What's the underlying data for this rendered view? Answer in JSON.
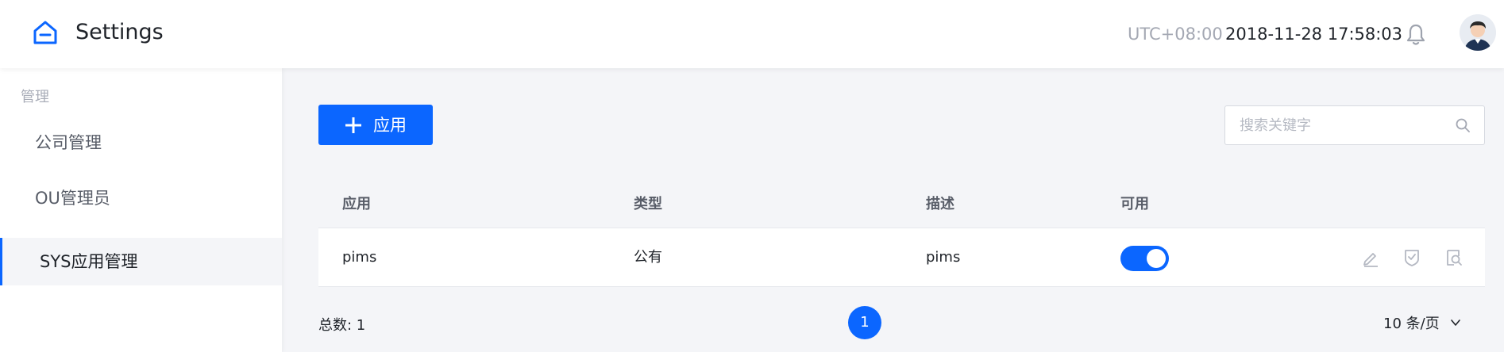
{
  "header": {
    "title": "Settings",
    "timezone": "UTC+08:00",
    "datetime": "2018-11-28 17:58:03",
    "icons": {
      "logo": "home-icon",
      "notifications": "bell-icon",
      "user": "avatar"
    }
  },
  "sidebar": {
    "group_label": "管理",
    "items": [
      {
        "label": "公司管理",
        "active": false
      },
      {
        "label": "OU管理员",
        "active": false
      },
      {
        "label": "SYS应用管理",
        "active": true
      }
    ]
  },
  "toolbar": {
    "add_label": "应用",
    "search_placeholder": "搜索关键字",
    "search_value": ""
  },
  "table": {
    "columns": [
      "应用",
      "类型",
      "描述",
      "可用"
    ],
    "rows": [
      {
        "app": "pims",
        "type": "公有",
        "description": "pims",
        "enabled": true,
        "actions": [
          "edit-icon",
          "shield-check-icon",
          "search-doc-icon"
        ]
      }
    ]
  },
  "pagination": {
    "total_label": "总数: 1",
    "current_page": "1",
    "page_size_label": "10 条/页"
  },
  "colors": {
    "accent": "#0b66ff",
    "text": "#1f2329",
    "muted": "#a4a8b3",
    "header_bg": "#f4f5f8"
  }
}
